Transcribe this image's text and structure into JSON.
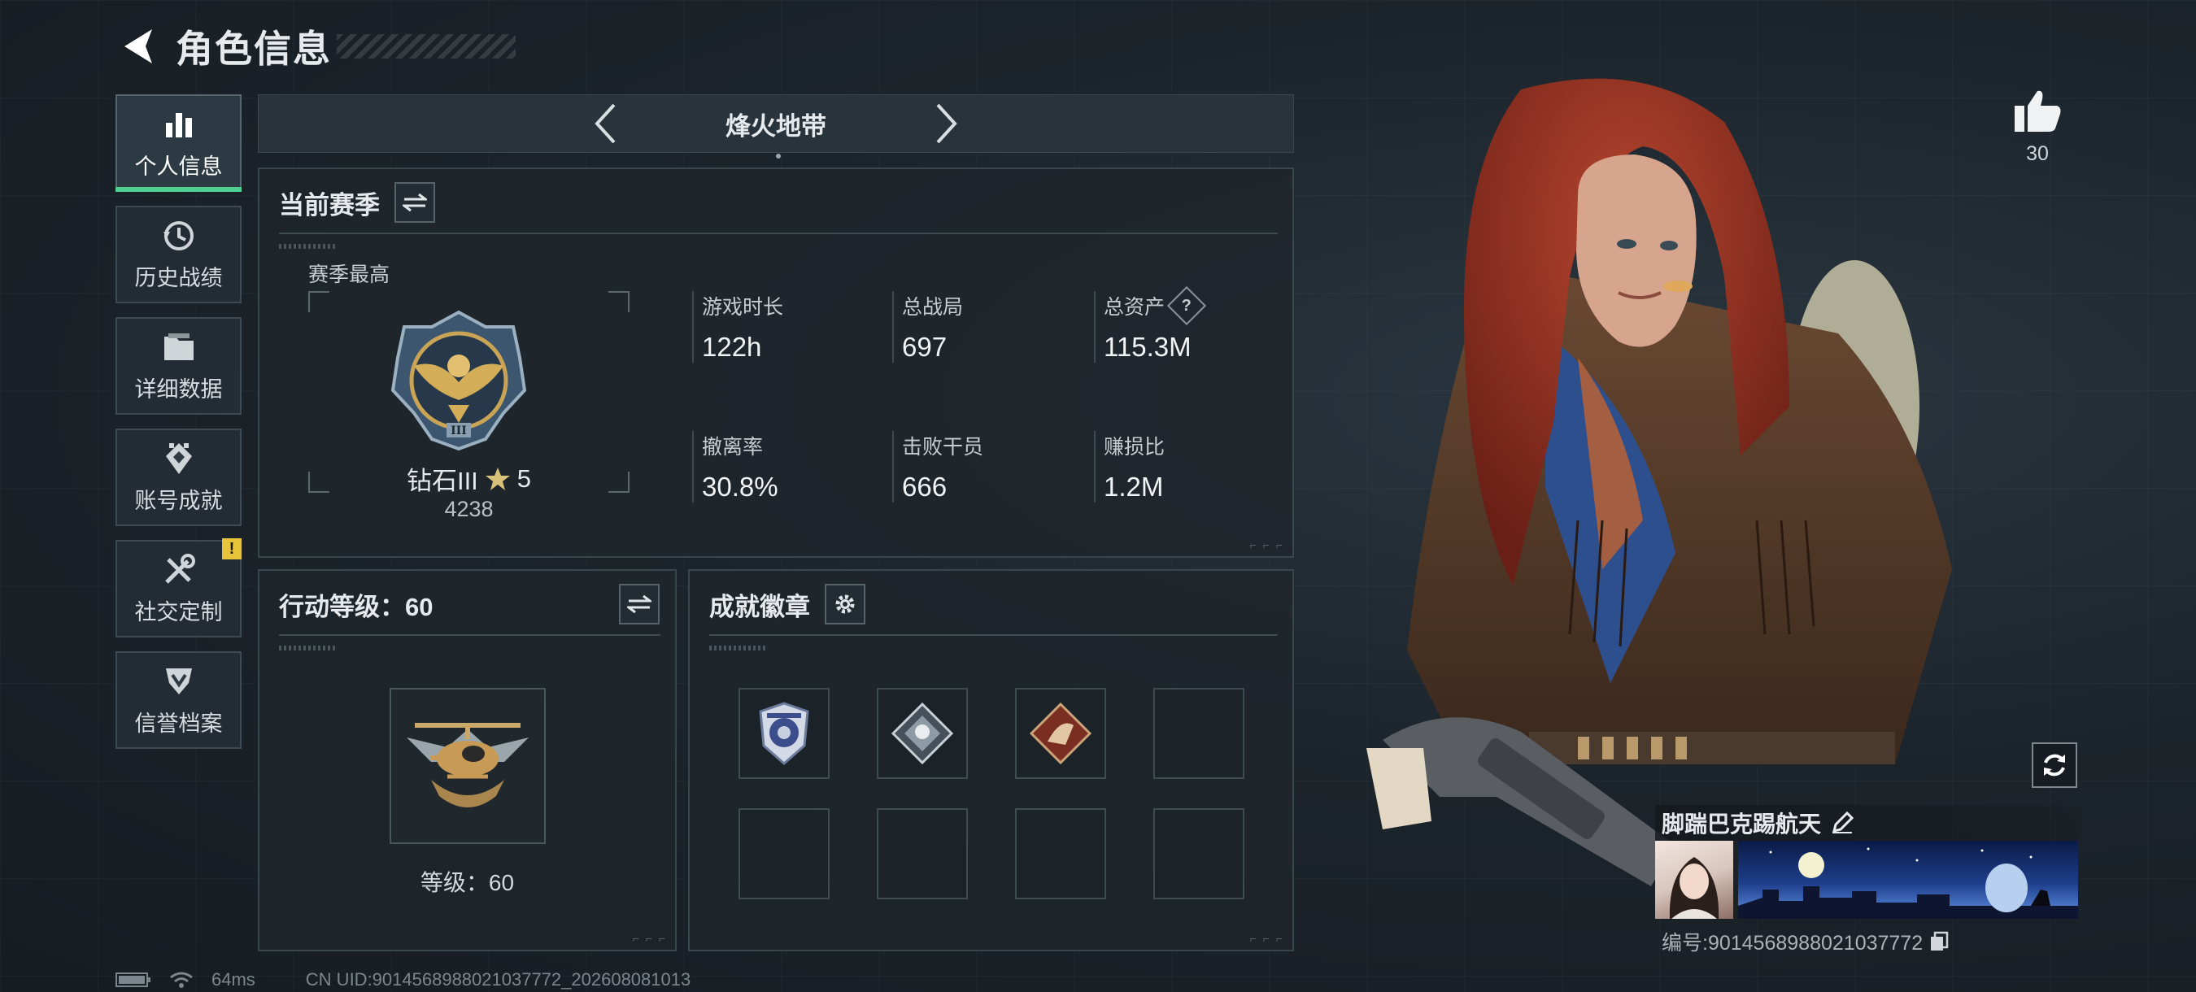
{
  "header": {
    "title": "角色信息"
  },
  "sidebar": {
    "items": [
      {
        "label": "个人信息",
        "icon": "bar-chart-icon",
        "active": true
      },
      {
        "label": "历史战绩",
        "icon": "history-icon"
      },
      {
        "label": "详细数据",
        "icon": "folder-icon"
      },
      {
        "label": "账号成就",
        "icon": "achievement-icon"
      },
      {
        "label": "社交定制",
        "icon": "tools-icon",
        "alert": "!"
      },
      {
        "label": "信誉档案",
        "icon": "shield-icon"
      }
    ]
  },
  "map": {
    "name": "烽火地带"
  },
  "season": {
    "title": "当前赛季",
    "best_label": "赛季最高",
    "rank_name": "钻石III",
    "rank_stars": "5",
    "rank_score": "4238",
    "stats": [
      {
        "label": "游戏时长",
        "value": "122h"
      },
      {
        "label": "总战局",
        "value": "697"
      },
      {
        "label": "总资产",
        "value": "115.3M",
        "help": "?"
      },
      {
        "label": "撤离率",
        "value": "30.8%"
      },
      {
        "label": "击败干员",
        "value": "666"
      },
      {
        "label": "赚损比",
        "value": "1.2M"
      }
    ]
  },
  "level": {
    "title": "行动等级：60",
    "level_text": "等级：60"
  },
  "badges": {
    "title": "成就徽章"
  },
  "likes": {
    "count": "30"
  },
  "profile": {
    "name": "脚踹巴克踢航天",
    "uid_text": "编号:9014568988021037772"
  },
  "status": {
    "ping": "64ms",
    "cn_uid": "CN UID:9014568988021037772_202608081013"
  },
  "colors": {
    "accent": "#4fcf8f",
    "alert": "#e8c43a",
    "background": "#1a2128"
  }
}
